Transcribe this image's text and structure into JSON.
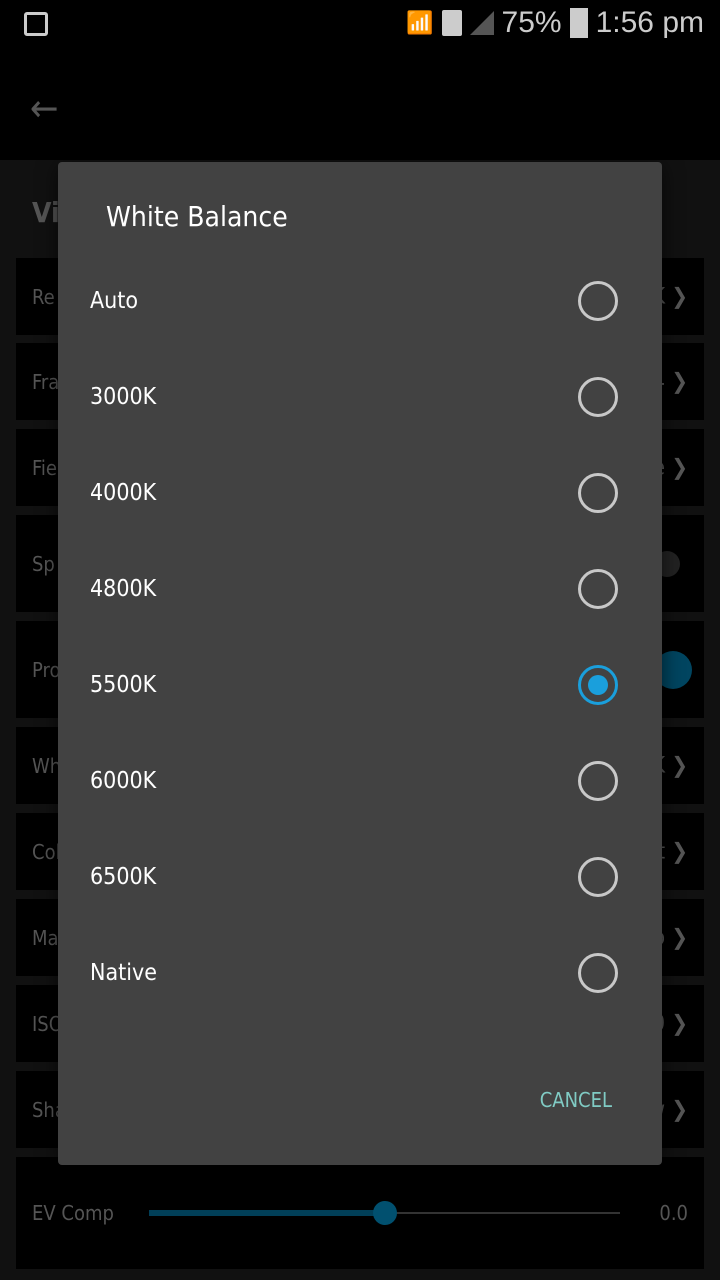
{
  "status_bar": {
    "battery": "75%",
    "time": "1:56 pm"
  },
  "background": {
    "section_fragment": "Vi",
    "rows": [
      {
        "label": "Re",
        "value": "K",
        "type": "chevron"
      },
      {
        "label": "Fra",
        "value": "4",
        "type": "chevron"
      },
      {
        "label": "Fie",
        "value": "e",
        "type": "chevron"
      },
      {
        "label": "Sp",
        "value": "",
        "type": "toggle",
        "on": false
      },
      {
        "label": "Pro",
        "value": "",
        "type": "toggle",
        "on": true
      },
      {
        "label": "Wh",
        "value": "K",
        "type": "chevron"
      },
      {
        "label": "Col",
        "value": "t",
        "type": "chevron"
      },
      {
        "label": "Ma",
        "value": "o",
        "type": "chevron"
      },
      {
        "label": "ISO",
        "value": "0",
        "type": "chevron"
      },
      {
        "label": "Sha",
        "value": "w",
        "type": "chevron"
      }
    ],
    "ev": {
      "label": "EV Comp",
      "value": "0.0",
      "slider_fraction": 0.5
    }
  },
  "dialog": {
    "title": "White Balance",
    "options": [
      "Auto",
      "3000K",
      "4000K",
      "4800K",
      "5500K",
      "6000K",
      "6500K",
      "Native"
    ],
    "selected": "5500K",
    "cancel": "CANCEL"
  },
  "colors": {
    "accent": "#1a9fdc",
    "cancel": "#80cbc4",
    "dialog_bg": "#424242"
  }
}
